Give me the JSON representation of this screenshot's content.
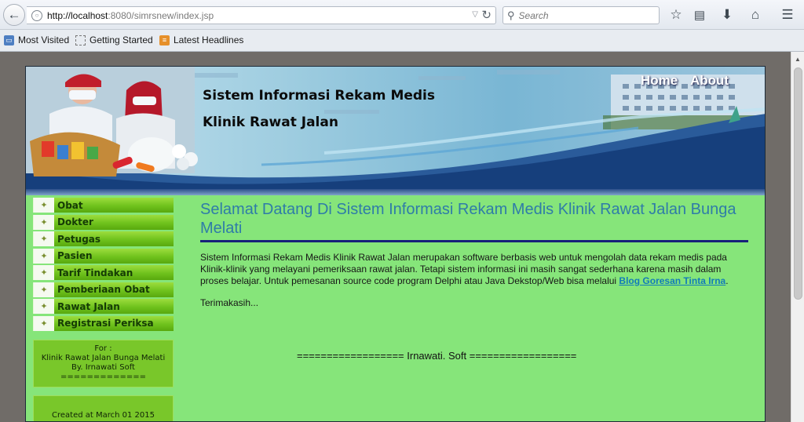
{
  "browser": {
    "url_host": "http://localhost",
    "url_rest": ":8080/simrsnew/index.jsp",
    "search_placeholder": "Search",
    "bookmarks": [
      {
        "label": "Most Visited",
        "icon": "bookmark-folder-icon"
      },
      {
        "label": "Getting Started",
        "icon": "page-icon"
      },
      {
        "label": "Latest Headlines",
        "icon": "rss-icon"
      }
    ]
  },
  "banner": {
    "title_line1": "Sistem Informasi Rekam Medis",
    "title_line2": "Klinik Rawat Jalan",
    "nav": [
      "Home",
      "About"
    ]
  },
  "sidebar": {
    "menu": [
      "Obat",
      "Dokter",
      "Petugas",
      "Pasien",
      "Tarif Tindakan",
      "Pemberiaan Obat",
      "Rawat Jalan",
      "Registrasi Periksa"
    ],
    "info_lines": [
      "For :",
      "Klinik Rawat Jalan Bunga Melati",
      "By. Irnawati Soft",
      "============="
    ],
    "created": "Created at March 01 2015"
  },
  "main": {
    "heading": "Selamat Datang Di Sistem Informasi Rekam Medis Klinik Rawat Jalan Bunga Melati",
    "paragraph_before_link": "Sistem Informasi Rekam Medis Klinik Rawat Jalan merupakan software berbasis web untuk mengolah data rekam medis pada Klinik-klinik yang melayani pemeriksaan rawat jalan. Tetapi sistem informasi ini masih sangat sederhana karena masih dalam proses belajar. Untuk pemesanan source code program Delphi atau Java Dekstop/Web bisa melalui ",
    "link_text": "Blog Goresan Tinta Irna",
    "paragraph_after_link": ".",
    "thanks": "Terimakasih...",
    "footer": "================== Irnawati. Soft =================="
  },
  "colors": {
    "page_bg": "#86e57a",
    "menu_green": "#6fc21d",
    "heading_blue": "#2f7ca8",
    "rule_navy": "#17207a",
    "link_blue": "#127cb9"
  }
}
